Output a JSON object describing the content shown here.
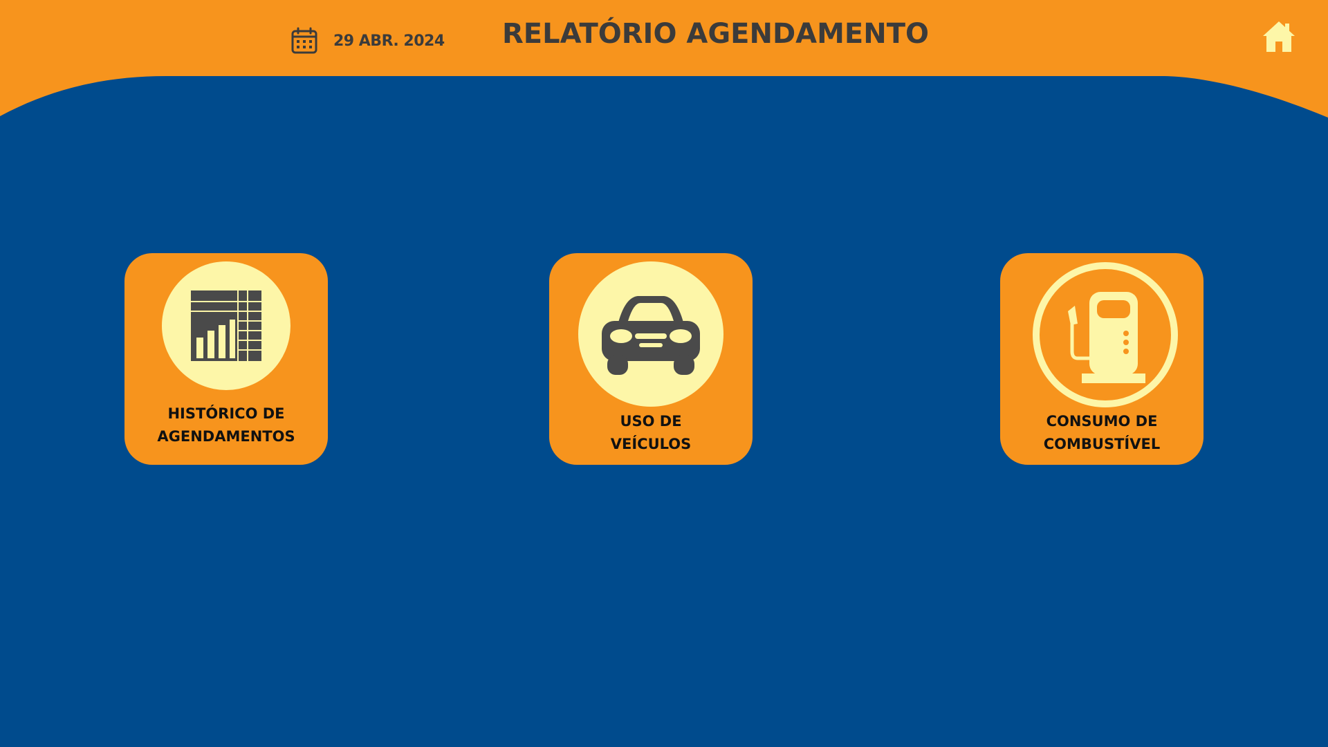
{
  "header": {
    "date": "29 ABR. 2024",
    "title": "RELATÓRIO AGENDAMENTO"
  },
  "colors": {
    "background": "#004b8d",
    "accent": "#f7941d",
    "icon_fill": "#fdf6a8",
    "text_dark": "#3b3b3b"
  },
  "cards": [
    {
      "line1": "HISTÓRICO DE",
      "line2": "AGENDAMENTOS",
      "icon": "chart-table-icon"
    },
    {
      "line1": "USO DE",
      "line2": "VEÍCULOS",
      "icon": "car-icon"
    },
    {
      "line1": "CONSUMO DE",
      "line2": "COMBUSTÍVEL",
      "icon": "fuel-pump-icon"
    }
  ]
}
